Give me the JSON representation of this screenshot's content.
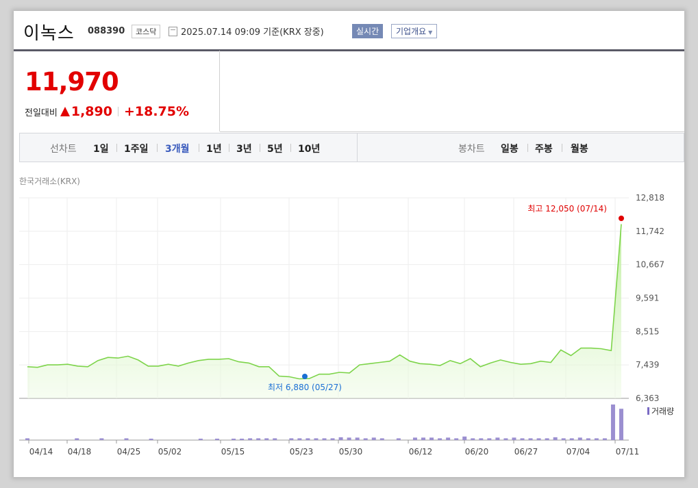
{
  "stock": {
    "name": "이녹스",
    "code": "088390",
    "market": "코스닥",
    "datetime": "2025.07.14 09:09",
    "basis": "기준(KRX 장중)",
    "realtime_label": "실시간",
    "company_info_label": "기업개요",
    "price": "11,970",
    "change_label": "전일대비",
    "change_value": "1,890",
    "change_pct": "+18.75%"
  },
  "tabs": {
    "line_chart_label": "선차트",
    "line_periods": [
      "1일",
      "1주일",
      "3개월",
      "1년",
      "3년",
      "5년",
      "10년"
    ],
    "active_period": "3개월",
    "candle_chart_label": "봉차트",
    "candle_periods": [
      "일봉",
      "주봉",
      "월봉"
    ]
  },
  "chart": {
    "source": "한국거래소(KRX)",
    "high_label": "최고 12,050 (07/14)",
    "low_label": "최저 6,880 (05/27)",
    "volume_label": "거래량"
  },
  "chart_data": {
    "type": "area",
    "title": "",
    "ylim": [
      6363,
      12818
    ],
    "yticks": [
      "12,818",
      "11,742",
      "10,667",
      "9,591",
      "8,515",
      "7,439",
      "6,363"
    ],
    "xtick_labels": [
      "04/14",
      "04/18",
      "04/25",
      "05/02",
      "05/15",
      "05/23",
      "05/30",
      "06/12",
      "06/20",
      "06/27",
      "07/04",
      "07/11"
    ],
    "grid": true,
    "color": "#7dd44a",
    "series": [
      {
        "values": [
          7380,
          7360,
          7440,
          7440,
          7460,
          7400,
          7380,
          7580,
          7680,
          7660,
          7720,
          7600,
          7400,
          7400,
          7460,
          7400,
          7500,
          7580,
          7620,
          7620,
          7640,
          7540,
          7500,
          7380,
          7380,
          7080,
          7060,
          6990,
          7000,
          7140,
          7140,
          7200,
          7180,
          7440,
          7480,
          7520,
          7560,
          7760,
          7560,
          7480,
          7460,
          7420,
          7580,
          7480,
          7640,
          7380,
          7500,
          7600,
          7520,
          7460,
          7480,
          7560,
          7520,
          7920,
          7740,
          7980,
          7980,
          7960,
          7900,
          11970
        ]
      }
    ],
    "volume_series": [
      {
        "name": "거래량",
        "values": [
          0.05,
          0,
          0,
          0,
          0,
          0,
          0.05,
          0,
          0,
          0.05,
          0,
          0,
          0.05,
          0,
          0,
          0.04,
          0,
          0,
          0,
          0,
          0,
          0.04,
          0,
          0.04,
          0,
          0.04,
          0.04,
          0.05,
          0.05,
          0.05,
          0.05,
          0,
          0.05,
          0.05,
          0.05,
          0.05,
          0.05,
          0.05,
          0.08,
          0.07,
          0.07,
          0.05,
          0.07,
          0.05,
          0,
          0.05,
          0,
          0.07,
          0.07,
          0.07,
          0.05,
          0.07,
          0.05,
          0.1,
          0.05,
          0.05,
          0.05,
          0.07,
          0.05,
          0.07,
          0.05,
          0.05,
          0.05,
          0.05,
          0.08,
          0.05,
          0.05,
          0.07,
          0.05,
          0.05,
          0.05,
          1.0,
          0.88
        ]
      }
    ]
  }
}
